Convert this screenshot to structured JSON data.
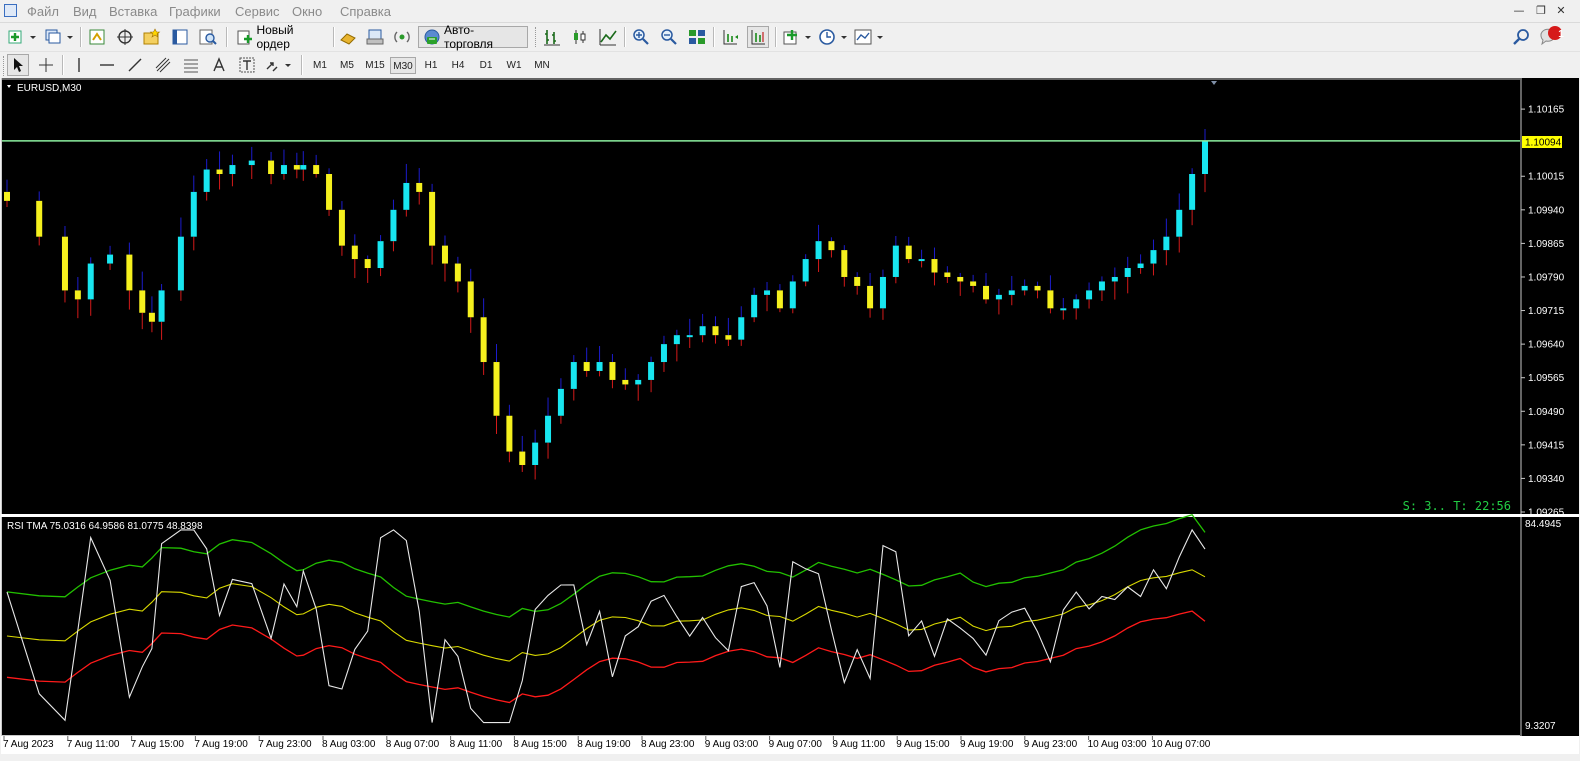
{
  "menu": {
    "items": [
      "Файл",
      "Вид",
      "Вставка",
      "Графики",
      "Сервис",
      "Окно",
      "Справка"
    ]
  },
  "toolbar": {
    "new_order_label": "Новый ордер",
    "autotrading_label": "Авто-торговля",
    "notification_count": "1"
  },
  "timeframes": [
    "M1",
    "M5",
    "M15",
    "M30",
    "H1",
    "H4",
    "D1",
    "W1",
    "MN"
  ],
  "active_timeframe": "M30",
  "chart": {
    "symbol_label": "EURUSD,M30",
    "current_price": "1.10094",
    "status_text": "S: 3.. T: 22:56",
    "price_ticks": [
      "1.10165",
      "1.10015",
      "1.09940",
      "1.09865",
      "1.09790",
      "1.09715",
      "1.09640",
      "1.09565",
      "1.09490",
      "1.09415",
      "1.09340",
      "1.09265"
    ],
    "time_ticks": [
      "7 Aug 2023",
      "7 Aug 11:00",
      "7 Aug 15:00",
      "7 Aug 19:00",
      "7 Aug 23:00",
      "8 Aug 03:00",
      "8 Aug 07:00",
      "8 Aug 11:00",
      "8 Aug 15:00",
      "8 Aug 19:00",
      "8 Aug 23:00",
      "9 Aug 03:00",
      "9 Aug 07:00",
      "9 Aug 11:00",
      "9 Aug 15:00",
      "9 Aug 19:00",
      "9 Aug 23:00",
      "10 Aug 03:00",
      "10 Aug 07:00"
    ],
    "colors": {
      "background": "#000000",
      "bull_candle": "#18e6f0",
      "bear_candle": "#f5f01e",
      "upper_wick": "#1c1ccc",
      "lower_wick": "#d41a1a",
      "price_line": "#8cf0a0",
      "price_badge": "#ffff00",
      "status_text": "#22cc44"
    }
  },
  "indicator": {
    "label": "RSI TMA 75.0316 64.9586 81.0775 48.8398",
    "scale_top": "84.4945",
    "scale_bottom": "9.3207",
    "colors": {
      "rsi": "#e8e8e8",
      "middle": "#d8d800",
      "upper_band": "#22c000",
      "lower_band": "#ff1a1a"
    }
  },
  "chart_data": {
    "type": "candlestick",
    "symbol": "EURUSD",
    "timeframe": "M30",
    "current_price": 1.10094,
    "y_range": [
      1.09265,
      1.1023
    ],
    "ohlc_close_trend": [
      [
        0,
        1.0996
      ],
      [
        10,
        1.0988
      ],
      [
        18,
        1.0976
      ],
      [
        22,
        1.0974
      ],
      [
        26,
        1.0982
      ],
      [
        32,
        1.0984
      ],
      [
        38,
        1.0976
      ],
      [
        42,
        1.0971
      ],
      [
        45,
        1.0969
      ],
      [
        48,
        1.0976
      ],
      [
        54,
        1.0988
      ],
      [
        58,
        1.0998
      ],
      [
        62,
        1.1003
      ],
      [
        66,
        1.1002
      ],
      [
        70,
        1.1004
      ],
      [
        76,
        1.1005
      ],
      [
        82,
        1.1002
      ],
      [
        86,
        1.1004
      ],
      [
        90,
        1.1003
      ],
      [
        92,
        1.1004
      ],
      [
        96,
        1.1002
      ],
      [
        100,
        1.0994
      ],
      [
        104,
        1.0986
      ],
      [
        108,
        1.0983
      ],
      [
        112,
        1.0981
      ],
      [
        116,
        1.0987
      ],
      [
        120,
        1.0994
      ],
      [
        124,
        1.1
      ],
      [
        128,
        1.0998
      ],
      [
        132,
        1.0986
      ],
      [
        136,
        1.0982
      ],
      [
        140,
        1.0978
      ],
      [
        144,
        1.097
      ],
      [
        148,
        1.096
      ],
      [
        152,
        1.0948
      ],
      [
        156,
        1.094
      ],
      [
        160,
        1.0937
      ],
      [
        164,
        1.0942
      ],
      [
        168,
        1.0948
      ],
      [
        172,
        1.0954
      ],
      [
        176,
        1.096
      ],
      [
        180,
        1.0958
      ],
      [
        184,
        1.096
      ],
      [
        188,
        1.0956
      ],
      [
        192,
        1.0955
      ],
      [
        196,
        1.0956
      ],
      [
        200,
        1.096
      ],
      [
        204,
        1.0964
      ],
      [
        208,
        1.0966
      ],
      [
        212,
        1.0966
      ],
      [
        216,
        1.0968
      ],
      [
        220,
        1.0966
      ],
      [
        224,
        1.0965
      ],
      [
        228,
        1.097
      ],
      [
        232,
        1.0975
      ],
      [
        236,
        1.0976
      ],
      [
        240,
        1.0972
      ],
      [
        244,
        1.0978
      ],
      [
        248,
        1.0983
      ],
      [
        252,
        1.0987
      ],
      [
        256,
        1.0985
      ],
      [
        260,
        1.0979
      ],
      [
        264,
        1.0977
      ],
      [
        268,
        1.0972
      ],
      [
        272,
        1.0979
      ],
      [
        276,
        1.0986
      ],
      [
        280,
        1.0983
      ],
      [
        284,
        1.0983
      ],
      [
        288,
        1.098
      ],
      [
        292,
        1.0979
      ],
      [
        296,
        1.0978
      ],
      [
        300,
        1.0977
      ],
      [
        304,
        1.0974
      ],
      [
        308,
        1.0975
      ],
      [
        312,
        1.0976
      ],
      [
        316,
        1.0977
      ],
      [
        320,
        1.0976
      ],
      [
        324,
        1.0972
      ],
      [
        328,
        1.0972
      ],
      [
        332,
        1.0974
      ],
      [
        336,
        1.0976
      ],
      [
        340,
        1.0978
      ],
      [
        344,
        1.0979
      ],
      [
        348,
        1.0981
      ],
      [
        352,
        1.0982
      ],
      [
        356,
        1.0985
      ],
      [
        360,
        1.0988
      ],
      [
        364,
        1.0994
      ],
      [
        368,
        1.1002
      ],
      [
        372,
        1.10094
      ]
    ],
    "rsi_tma": {
      "rsi": 75.0316,
      "middle": 64.9586,
      "upper": 81.0775,
      "lower": 48.8398
    },
    "indicator_y_range": [
      9.3207,
      84.4945
    ]
  }
}
